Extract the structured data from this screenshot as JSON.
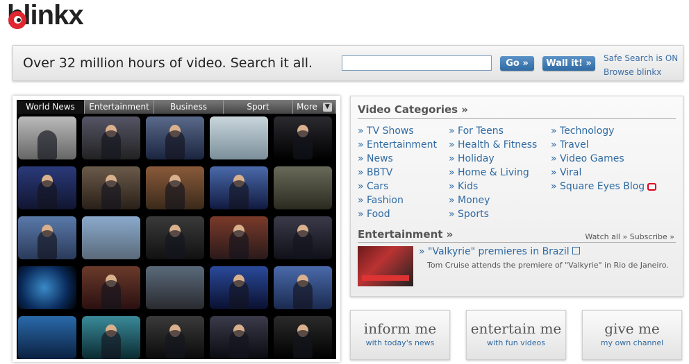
{
  "logo": {
    "text": "blinkx"
  },
  "search": {
    "tagline": "Over 32 million hours of video. Search it all.",
    "input_value": "",
    "go_label": "Go",
    "wall_label": "Wall it!",
    "safe_search": "Safe Search is ON",
    "browse": "Browse blinkx"
  },
  "video_tabs": [
    "World News",
    "Entertainment",
    "Business",
    "Sport",
    "More"
  ],
  "categories": {
    "title": "Video Categories »",
    "col1": [
      "» TV Shows",
      "» Entertainment",
      "» News",
      "» BBTV",
      "» Cars",
      "» Fashion",
      "» Food"
    ],
    "col2": [
      "» For Teens",
      "» Health & Fitness",
      "» Holiday",
      "» Home & Living",
      "» Kids",
      "» Money",
      "» Sports"
    ],
    "col3": [
      "» Technology",
      "» Travel",
      "» Video Games",
      "» Viral",
      "» Square Eyes Blog"
    ]
  },
  "entertainment": {
    "title": "Entertainment »",
    "watch_all": "Watch all »",
    "subscribe": "Subscribe »",
    "headline": "» \"Valkyrie\" premieres in Brazil",
    "description": "Tom Cruise attends the premiere of \"Valkyrie\" in Rio de Janeiro."
  },
  "cta": [
    {
      "big": "inform me",
      "small": "with today's news"
    },
    {
      "big": "entertain me",
      "small": "with fun videos"
    },
    {
      "big": "give me",
      "small": "my own channel"
    }
  ],
  "colors": {
    "link": "#2f6aa3",
    "brand_red": "#e0262e",
    "button": "#2f6aa3"
  }
}
